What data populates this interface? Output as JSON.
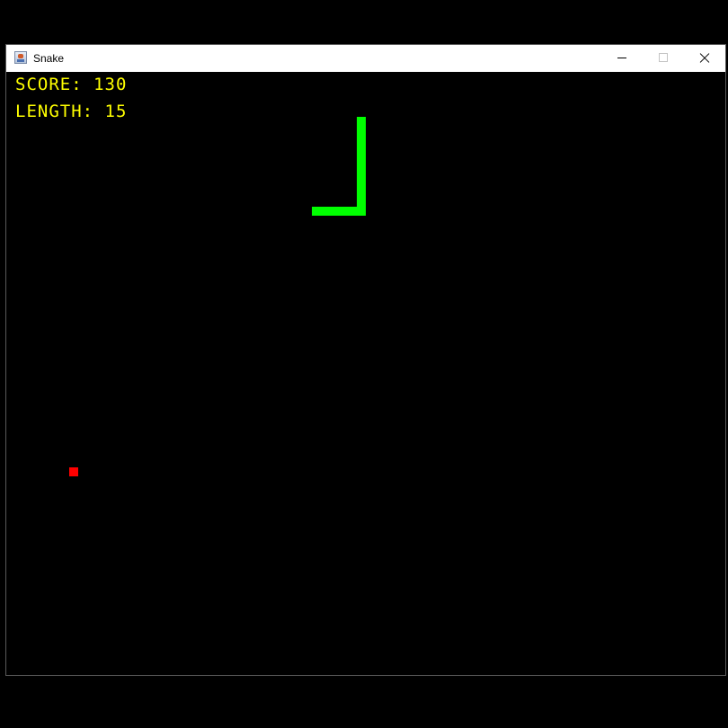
{
  "window": {
    "title": "Snake"
  },
  "hud": {
    "score_label": "SCORE:",
    "score_value": "130",
    "length_label": "LENGTH:",
    "length_value": "15"
  },
  "colors": {
    "background": "#000000",
    "hud_text": "#ffff00",
    "snake": "#00ff00",
    "food": "#ff0000"
  },
  "icons": {
    "app": "java-app-icon",
    "minimize": "minimize-icon",
    "maximize": "maximize-icon",
    "close": "close-icon"
  }
}
